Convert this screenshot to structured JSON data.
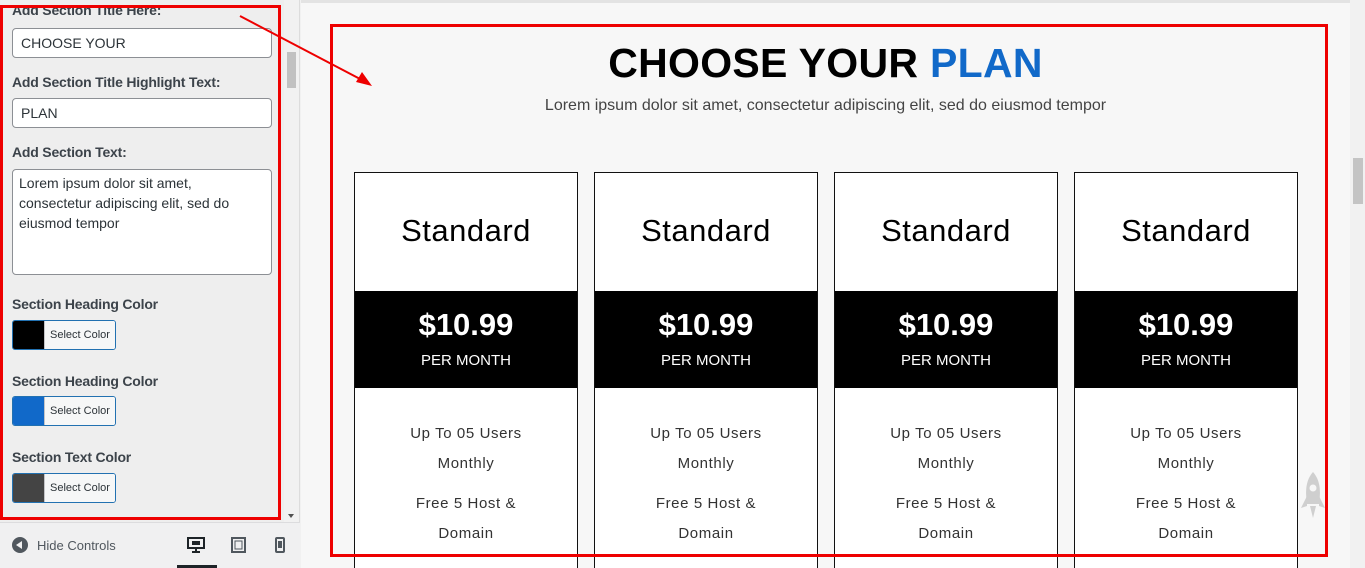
{
  "customizer": {
    "fields": [
      {
        "label": "Add Section Title Here:",
        "value": "CHOOSE YOUR"
      },
      {
        "label": "Add Section Title Highlight Text:",
        "value": "PLAN"
      },
      {
        "label": "Add Section Text:",
        "value": "Lorem ipsum dolor sit amet, consectetur adipiscing elit, sed do eiusmod tempor"
      }
    ],
    "colors": [
      {
        "label": "Section Heading Color",
        "button": "Select Color",
        "swatch": "#000000"
      },
      {
        "label": "Section Heading Color",
        "button": "Select Color",
        "swatch": "#1169c9"
      },
      {
        "label": "Section Text Color",
        "button": "Select Color",
        "swatch": "#444444"
      }
    ],
    "footer": {
      "hide_controls": "Hide Controls",
      "devices": [
        "desktop-icon",
        "tablet-icon",
        "mobile-icon"
      ],
      "active_device": "desktop"
    }
  },
  "preview": {
    "title": "CHOOSE YOUR",
    "title_highlight": "PLAN",
    "subtitle": "Lorem ipsum dolor sit amet, consectetur adipiscing elit, sed do eiusmod tempor",
    "plans": [
      {
        "name": "Standard",
        "price": "$10.99",
        "period": "PER MONTH",
        "features": [
          "Up To 05 Users",
          "Monthly",
          "Free 5 Host &",
          "Domain"
        ]
      },
      {
        "name": "Standard",
        "price": "$10.99",
        "period": "PER MONTH",
        "features": [
          "Up To 05 Users",
          "Monthly",
          "Free 5 Host &",
          "Domain"
        ]
      },
      {
        "name": "Standard",
        "price": "$10.99",
        "period": "PER MONTH",
        "features": [
          "Up To 05 Users",
          "Monthly",
          "Free 5 Host &",
          "Domain"
        ]
      },
      {
        "name": "Standard",
        "price": "$10.99",
        "period": "PER MONTH",
        "features": [
          "Up To 05 Users",
          "Monthly",
          "Free 5 Host &",
          "Domain"
        ]
      }
    ]
  },
  "colors": {
    "annotation": "#ee0000",
    "highlight": "#1169c9",
    "price_band": "#000000"
  }
}
